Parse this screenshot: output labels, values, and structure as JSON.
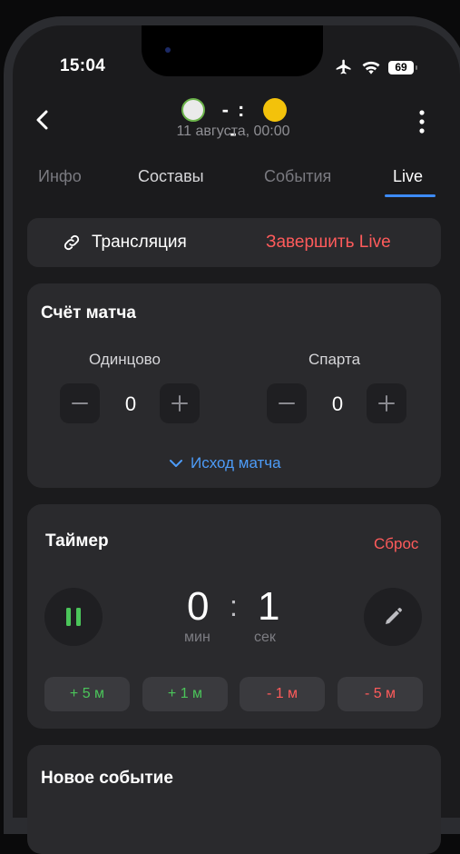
{
  "status_bar": {
    "time": "15:04",
    "battery": "69"
  },
  "header": {
    "score": "- : -",
    "date": "11 августа, 00:00"
  },
  "tabs": [
    {
      "label": "Инфо"
    },
    {
      "label": "Составы"
    },
    {
      "label": "События"
    },
    {
      "label": "Live"
    }
  ],
  "broadcast": {
    "label": "Трансляция",
    "end_label": "Завершить Live"
  },
  "score_card": {
    "title": "Счёт матча",
    "team1": {
      "name": "Одинцово",
      "score": "0"
    },
    "team2": {
      "name": "Спарта",
      "score": "0"
    },
    "outcome_label": "Исход матча"
  },
  "timer": {
    "title": "Таймер",
    "reset_label": "Сброс",
    "minutes": "0",
    "seconds": "1",
    "colon": ":",
    "min_label": "мин",
    "sec_label": "сек",
    "adjust": [
      "+ 5 м",
      "+ 1 м",
      "- 1 м",
      "- 5 м"
    ]
  },
  "new_event": {
    "title": "Новое событие"
  },
  "colors": {
    "accent": "#3d8bf6",
    "danger": "#ff5b5b",
    "success": "#4bc55a",
    "card": "#2a2a2d"
  }
}
